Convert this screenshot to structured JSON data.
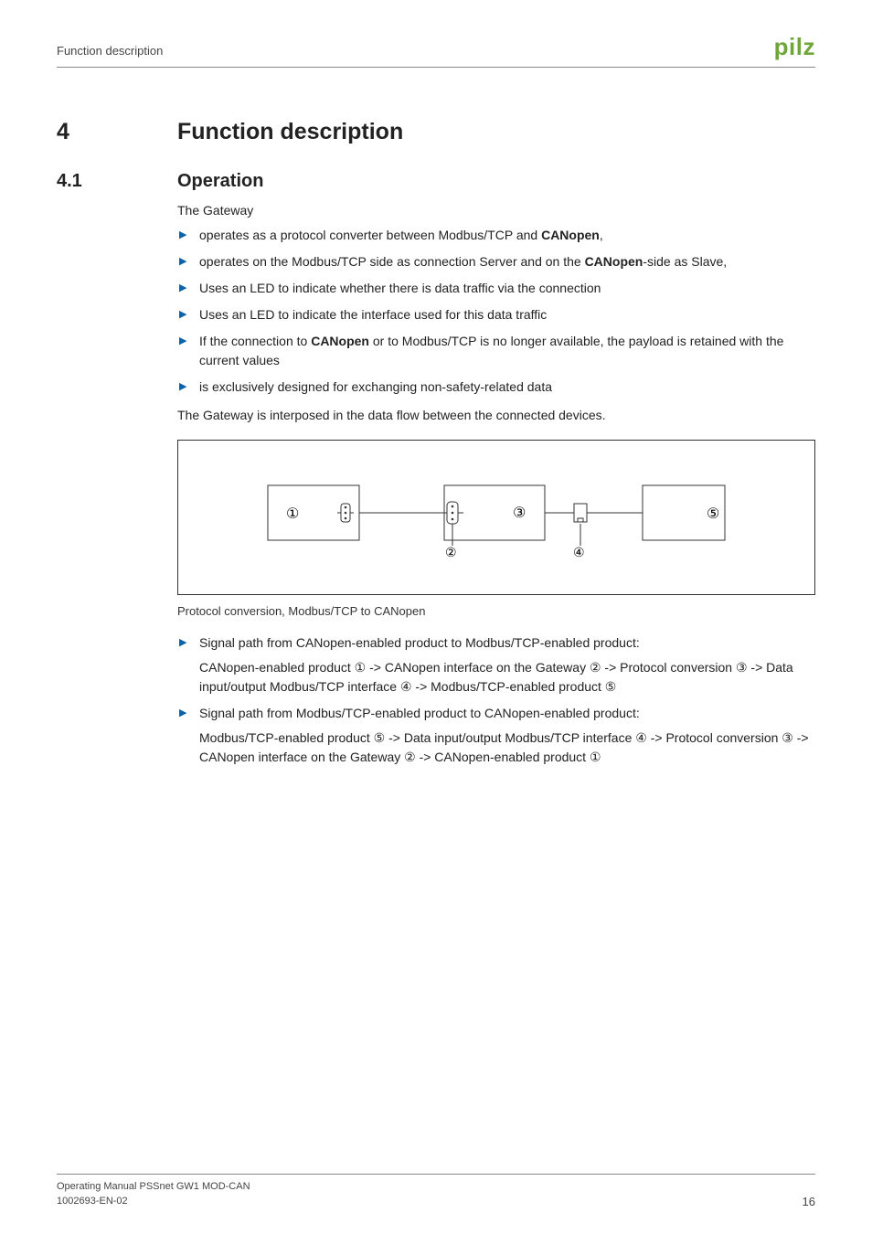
{
  "running_header": {
    "left": "Function description"
  },
  "logo": "pilz",
  "section": {
    "h1_num": "4",
    "h1_text": "Function description",
    "h2_num": "4.1",
    "h2_text": "Operation"
  },
  "intro": "The Gateway",
  "bullets_a": [
    {
      "pre": "operates as a protocol converter between Modbus/TCP and ",
      "bold": "CANopen",
      "post": ","
    },
    {
      "pre": "operates on the Modbus/TCP side as connection Server and on the ",
      "bold": "CANopen",
      "post": "-side as Slave,"
    },
    {
      "text": "Uses an LED to indicate whether there is data traffic via the connection"
    },
    {
      "text": "Uses an LED to indicate the interface used for this data traffic"
    },
    {
      "pre": "If the connection to ",
      "bold": "CANopen",
      "post": " or to Modbus/TCP is no longer available, the payload is retained with the current values"
    },
    {
      "text": "is exclusively designed for exchanging non-safety-related data"
    }
  ],
  "after_a": "The Gateway is interposed in the data flow between the connected devices.",
  "figure_caption": "Protocol conversion, Modbus/TCP to CANopen",
  "fig_labels": {
    "n1": "①",
    "n2": "②",
    "n3": "③",
    "n4": "④",
    "n5": "⑤"
  },
  "bullets_b": [
    {
      "lead": "Signal path from CANopen-enabled product to Modbus/TCP-enabled product:",
      "body": "CANopen-enabled product ① -> CANopen interface on the Gateway ② -> Protocol conversion ③ -> Data input/output Modbus/TCP interface ④ -> Modbus/TCP-enabled product ⑤"
    },
    {
      "lead": "Signal path from Modbus/TCP-enabled product to CANopen-enabled product:",
      "body": "Modbus/TCP-enabled product ⑤ -> Data input/output Modbus/TCP interface ④ -> Protocol conversion ③ -> CANopen interface on the Gateway ② -> CANopen-enabled product ①"
    }
  ],
  "footer": {
    "line1": "Operating Manual PSSnet GW1 MOD-CAN",
    "line2": "1002693-EN-02",
    "page": "16"
  }
}
